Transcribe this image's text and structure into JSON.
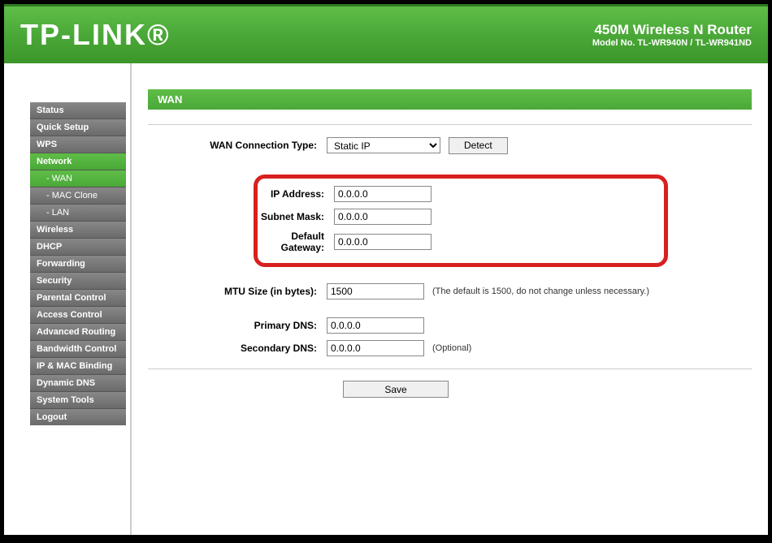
{
  "header": {
    "logo": "TP-LINK",
    "title": "450M Wireless N Router",
    "model": "Model No. TL-WR940N / TL-WR941ND"
  },
  "sidebar": {
    "items": [
      {
        "label": "Status",
        "active": false
      },
      {
        "label": "Quick Setup",
        "active": false
      },
      {
        "label": "WPS",
        "active": false
      },
      {
        "label": "Network",
        "active": true,
        "children": [
          {
            "label": "- WAN",
            "active": true
          },
          {
            "label": "- MAC Clone",
            "active": false
          },
          {
            "label": "- LAN",
            "active": false
          }
        ]
      },
      {
        "label": "Wireless",
        "active": false
      },
      {
        "label": "DHCP",
        "active": false
      },
      {
        "label": "Forwarding",
        "active": false
      },
      {
        "label": "Security",
        "active": false
      },
      {
        "label": "Parental Control",
        "active": false
      },
      {
        "label": "Access Control",
        "active": false
      },
      {
        "label": "Advanced Routing",
        "active": false
      },
      {
        "label": "Bandwidth Control",
        "active": false
      },
      {
        "label": "IP & MAC Binding",
        "active": false
      },
      {
        "label": "Dynamic DNS",
        "active": false
      },
      {
        "label": "System Tools",
        "active": false
      },
      {
        "label": "Logout",
        "active": false
      }
    ]
  },
  "page": {
    "title": "WAN"
  },
  "form": {
    "conn_type_label": "WAN Connection Type:",
    "conn_type_value": "Static IP",
    "detect_label": "Detect",
    "ip_label": "IP Address:",
    "ip_value": "0.0.0.0",
    "mask_label": "Subnet Mask:",
    "mask_value": "0.0.0.0",
    "gateway_label": "Default Gateway:",
    "gateway_value": "0.0.0.0",
    "mtu_label": "MTU Size (in bytes):",
    "mtu_value": "1500",
    "mtu_hint": "(The default is 1500, do not change unless necessary.)",
    "dns1_label": "Primary DNS:",
    "dns1_value": "0.0.0.0",
    "dns2_label": "Secondary DNS:",
    "dns2_value": "0.0.0.0",
    "dns2_hint": "(Optional)",
    "save_label": "Save"
  }
}
